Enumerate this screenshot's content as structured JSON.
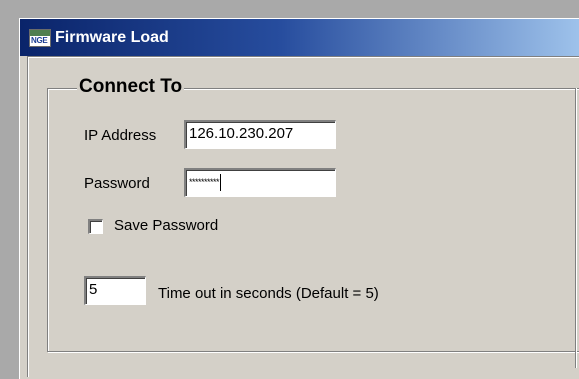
{
  "window": {
    "title": "Firmware Load",
    "icon_text": "NGE"
  },
  "connect_group": {
    "title": "Connect To",
    "ip_label": "IP Address",
    "ip_value": "126.10.230.207",
    "password_label": "Password",
    "password_value": "**********",
    "save_password_label": "Save Password",
    "save_password_checked": false,
    "timeout_value": "5",
    "timeout_label": "Time out in seconds (Default = 5)"
  }
}
